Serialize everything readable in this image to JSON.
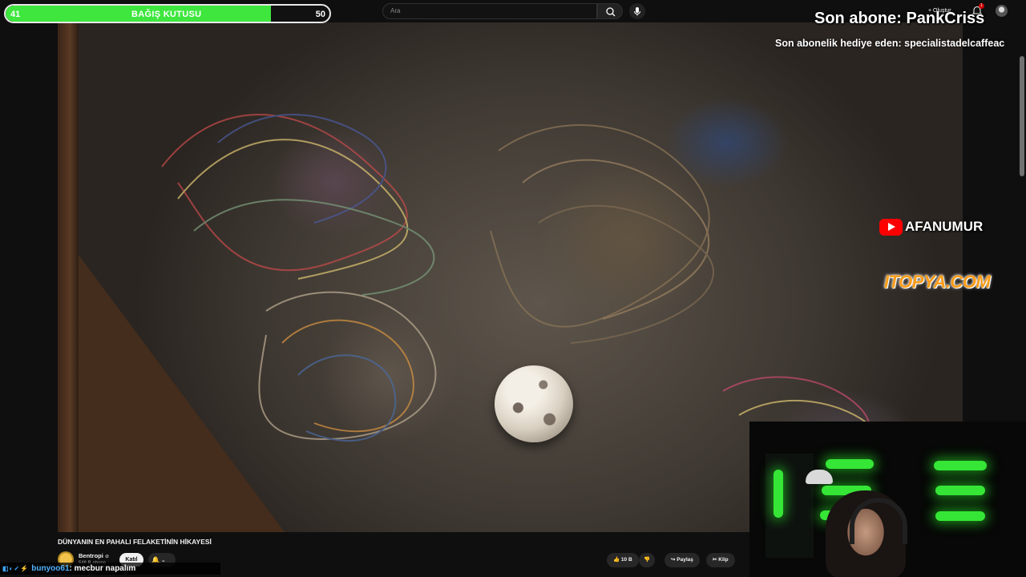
{
  "topbar": {
    "search_placeholder": "Ara",
    "create_label": "Oluştur",
    "notification_count": "1"
  },
  "donation_bar": {
    "title": "BAĞIŞ KUTUSU",
    "current": "41",
    "goal": "50",
    "progress_fraction": 0.82,
    "fill_color": "#3ee63e"
  },
  "overlays": {
    "last_subscriber": "Son abone: PankCriss",
    "last_gift_sub": "Son abonelik hediye eden: specialistadelcaffeac"
  },
  "watermarks": {
    "youtube_channel": "AFANUMUR",
    "sponsor": "ITOPYA.COM"
  },
  "video": {
    "title": "DÜNYANIN EN PAHALI FELAKETİNİN HİKAYESİ",
    "channel_name": "Bentropi",
    "channel_subs": "546 B abone",
    "join_label": "Katıl",
    "like_count": "10 B",
    "share_label": "Paylaş",
    "clip_label": "Klip"
  },
  "chat": {
    "username": "bunyoo61",
    "message": ": mecbur napalım"
  },
  "icons": [
    "search-icon",
    "mic-icon",
    "plus-icon",
    "bell-icon",
    "like-icon",
    "dislike-icon",
    "share-icon",
    "clip-icon",
    "verified-icon"
  ]
}
